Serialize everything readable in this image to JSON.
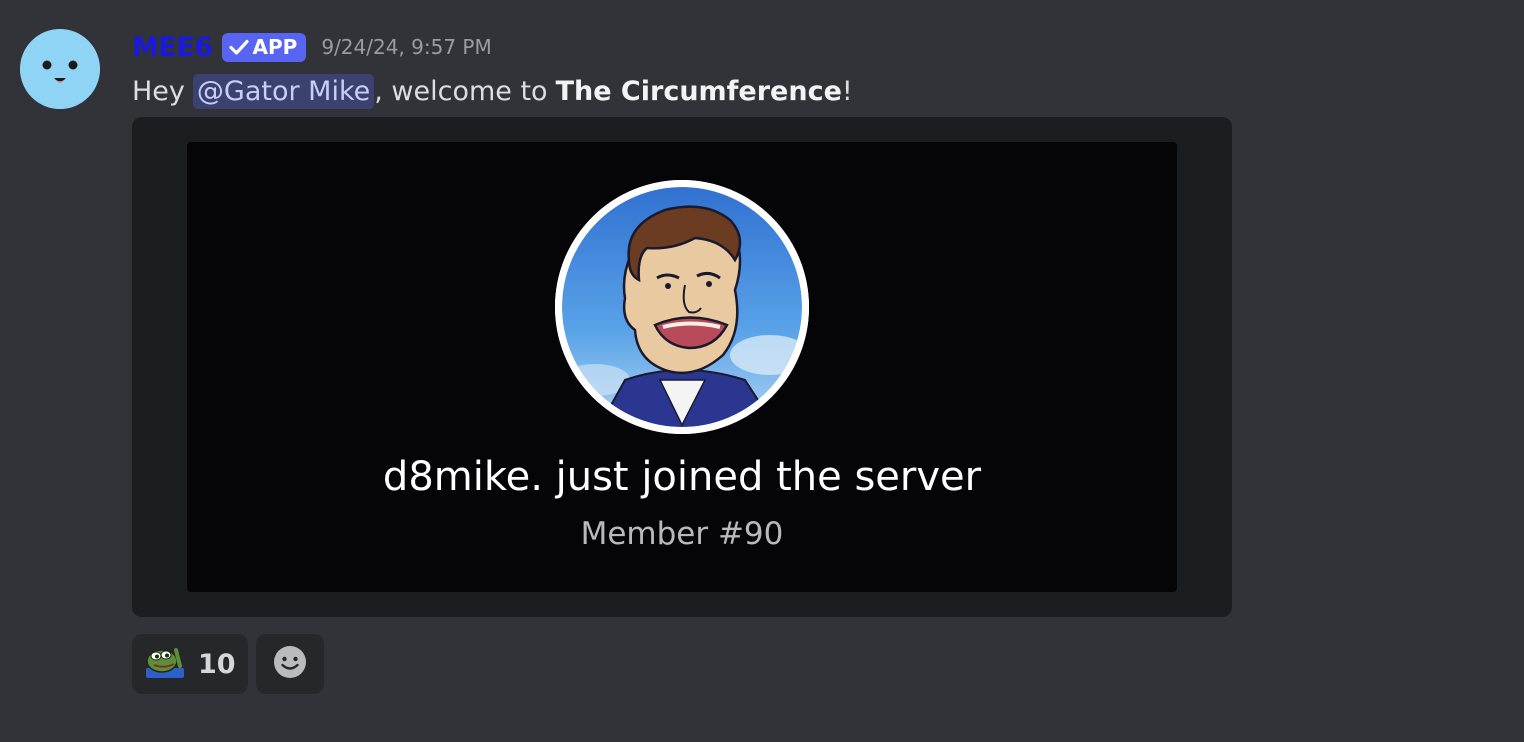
{
  "message": {
    "author": "MEE6",
    "app_tag": "APP",
    "timestamp": "9/24/24, 9:57 PM",
    "greeting": "Hey",
    "mention": "@Gator Mike",
    "welcome_text": ", welcome to",
    "server_name": "The Circumference",
    "end_punct": "!"
  },
  "embed": {
    "join_text": "d8mike. just joined the server",
    "member_text": "Member #90"
  },
  "reactions": [
    {
      "icon": "pepe-frog-emoji-icon",
      "count": "10"
    }
  ],
  "add_reaction": {
    "icon": "smiley-add-reaction-icon"
  },
  "colors": {
    "background": "#323339",
    "author": "#1a1adf",
    "app_tag": "#5865f2",
    "mention_bg": "#3c4270",
    "embed_bg": "#1c1d21",
    "avatar_bg": "#8fd4f4"
  }
}
